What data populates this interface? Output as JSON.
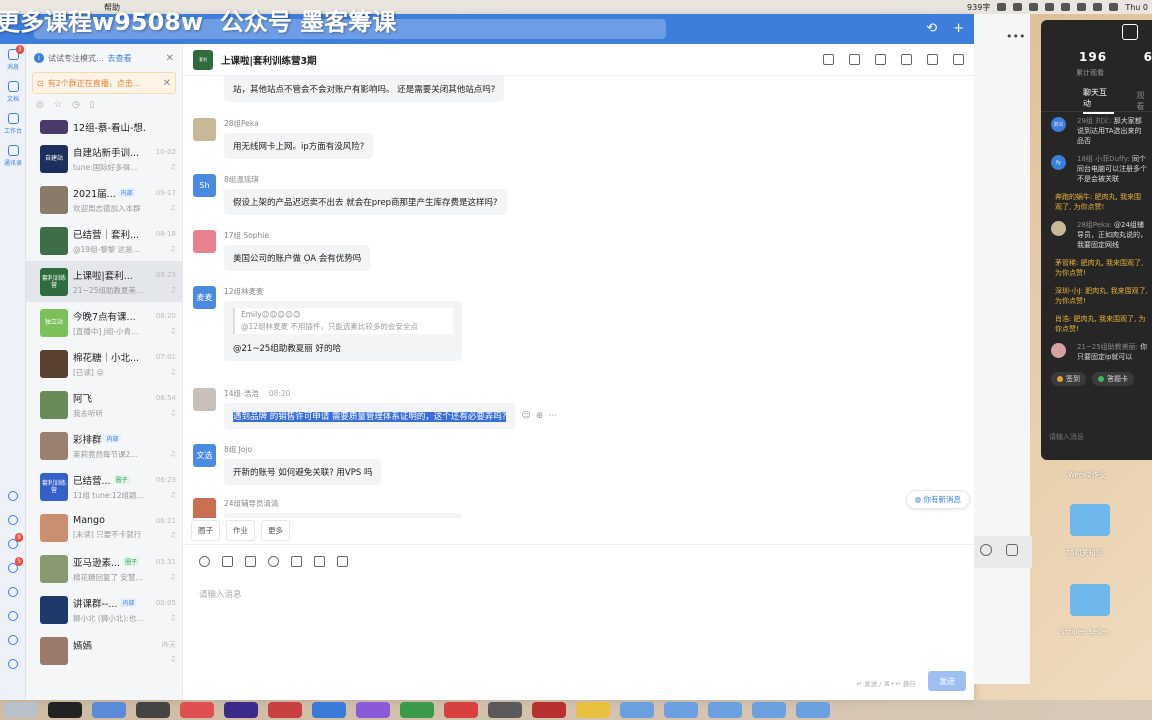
{
  "watermark": {
    "prefix": "更多课程",
    "brand": "w9508w",
    "suffix": "公众号 墨客筹课"
  },
  "menubar": {
    "help": "帮助",
    "stats": "939字",
    "clock": "Thu 0"
  },
  "rail": {
    "items": [
      {
        "label": "消息",
        "badge": "3"
      },
      {
        "label": "文档",
        "badge": ""
      },
      {
        "label": "工作台",
        "badge": ""
      },
      {
        "label": "通讯录",
        "badge": ""
      }
    ],
    "badges": [
      "9",
      "5"
    ]
  },
  "notices": {
    "tip_text": "试试专注模式...",
    "tip_link": "去查看",
    "live_text": "有2个群正在直播，点击..."
  },
  "conversations": [
    {
      "name": "12组-蔡-看山-想...",
      "tag": "",
      "time": "",
      "msg": "",
      "avatar_text": "",
      "avatar_color": "#4b3b6b"
    },
    {
      "name": "自建站新手训...",
      "tag": "",
      "time": "10-02",
      "msg": "tune:国际好多得...",
      "avatar_text": "自建站",
      "avatar_color": "#1d2f5c"
    },
    {
      "name": "2021届...",
      "tag": "内部",
      "time": "09-17",
      "msg": "欢迎周志德加入本群",
      "avatar_text": "",
      "avatar_color": "#8a7a6a"
    },
    {
      "name": "已结营｜套利...",
      "tag": "",
      "time": "08-18",
      "msg": "@19组-黎黎 这是...",
      "avatar_text": "",
      "avatar_color": "#3e6e48"
    },
    {
      "name": "上课啦|套利...",
      "tag": "",
      "time": "08:23",
      "msg": "21~25组助教夏美...",
      "avatar_text": "套利训练营",
      "avatar_color": "#2e6b3d",
      "active": true
    },
    {
      "name": "今晚7点有课...",
      "tag": "",
      "time": "08:20",
      "msg": "[直播中] J组-小青...",
      "avatar_text": "独立站",
      "avatar_color": "#7cc05a",
      "live": true
    },
    {
      "name": "棉花糖｜小北...",
      "tag": "",
      "time": "07:01",
      "msg": "[已读] 😜",
      "avatar_text": "",
      "avatar_color": "#5a4030"
    },
    {
      "name": "阿飞",
      "tag": "",
      "time": "06:54",
      "msg": "我去听听",
      "avatar_text": "",
      "avatar_color": "#6b8a5a"
    },
    {
      "name": "彩排群",
      "tag": "内部",
      "time": "",
      "msg": "莱莉竟然每节课2...",
      "avatar_text": "",
      "avatar_color": "#9a8070"
    },
    {
      "name": "已结营...",
      "tag": "圈子",
      "time": "06:23",
      "msg": "11组 tune:12组颖...",
      "avatar_text": "套利训练营",
      "avatar_color": "#3460c8"
    },
    {
      "name": "Mango",
      "tag": "",
      "time": "06:21",
      "msg": "[未读] 只要不卡就行",
      "avatar_text": "",
      "avatar_color": "#c89070",
      "unread": true
    },
    {
      "name": "亚马逊素...",
      "tag": "圈子",
      "time": "03:31",
      "msg": "棉花糖回复了 安慧...",
      "avatar_text": "",
      "avatar_color": "#8a9a70"
    },
    {
      "name": "讲课群--...",
      "tag": "内部",
      "time": "00:05",
      "msg": "狮小北 (狮小北):也...",
      "avatar_text": "",
      "avatar_color": "#1d3a6b"
    },
    {
      "name": "嫣嫣",
      "tag": "",
      "time": "昨天",
      "msg": "",
      "avatar_text": "",
      "avatar_color": "#9a7a6a"
    }
  ],
  "chat": {
    "title": "上课啦|套利训练营3期",
    "messages": [
      {
        "sender": "",
        "time": "",
        "text": "站，其他站点不管会不会对账户有影响吗。 还是需要关闭其他站点吗?",
        "avatar_text": "",
        "avatar_color": ""
      },
      {
        "sender": "28组Peka",
        "time": "",
        "text": "用无线网卡上网。ip方面有没风险?",
        "avatar_text": "",
        "avatar_color": "#c8b898"
      },
      {
        "sender": "8组温瑶琪",
        "time": "",
        "text": "假设上架的产品迟迟卖不出去 就会在prep商那里产生库存费是这样吗?",
        "avatar_text": "Sh",
        "avatar_color": "#4a8ae0"
      },
      {
        "sender": "17组 Sophie",
        "time": "",
        "text": "美国公司的账户做 OA 会有优势吗",
        "avatar_text": "",
        "avatar_color": "#e88090"
      },
      {
        "sender": "12组林麦麦",
        "time": "",
        "quote_title": "Emily😊😊😊😊😊",
        "quote_text": "@12组林麦麦 不用插件，只能选素比较多的会安全点",
        "text": "@21~25组助教夏丽 好的哈",
        "avatar_text": "麦麦",
        "avatar_color": "#4a8ae0"
      },
      {
        "sender": "14组-浩浩",
        "time": "08:20",
        "text": "遇到品牌 的销售许可申请 需要质量管理体系证明的，这个还有必要弄吗?",
        "avatar_text": "",
        "avatar_color": "#c8c0b8"
      },
      {
        "sender": "8组 Jojo",
        "time": "",
        "text": "开新的账号 如何避免关联? 用VPS 吗",
        "avatar_text": "文选",
        "avatar_color": "#4a8ae0"
      },
      {
        "sender": "24组辅导员清清",
        "time": "",
        "text": "",
        "avatar_text": "",
        "avatar_color": "#c87050"
      }
    ],
    "new_msg": "你有新消息",
    "quick_tags": [
      "圈子",
      "作业",
      "更多"
    ],
    "input_placeholder": "请输入消息",
    "send_hint": "↵ 发送 / ⌘+↵ 换行",
    "send_label": "发送"
  },
  "live": {
    "viewers": "196",
    "viewers_label": "累计观看",
    "second_num": "6",
    "tab_active": "聊天互动",
    "tab_other": "观看",
    "comments": [
      {
        "name": "29组 刘义:",
        "text": "那大家都说到达用TA选出来的品否",
        "avatar_text": "刘义",
        "avatar_color": "#3d7ddc",
        "gift": false
      },
      {
        "name": "18组 小菲Duffy:",
        "text": "同个同台电脑可以注册多个不是会被关联",
        "avatar_text": "fy",
        "avatar_color": "#3d7ddc",
        "gift": false
      },
      {
        "name": "",
        "text": "奔跑的蜗牛: 肥肉丸, 我来围观了, 为你点赞!",
        "avatar_text": "",
        "avatar_color": "",
        "gift": true
      },
      {
        "name": "28组Peka:",
        "text": "@24组辅导员，正如肉丸说的，我要固定网线",
        "avatar_text": "",
        "avatar_color": "#c8b898",
        "gift": false
      },
      {
        "name": "",
        "text": "茅管稀: 肥肉丸, 我来围观了, 为你点赞!",
        "avatar_text": "",
        "avatar_color": "",
        "gift": true
      },
      {
        "name": "",
        "text": "深圳-小J: 肥肉丸, 我来围观了, 为你点赞!",
        "avatar_text": "",
        "avatar_color": "",
        "gift": true
      },
      {
        "name": "",
        "text": "肖浩: 肥肉丸, 我来围观了, 为你点赞!",
        "avatar_text": "",
        "avatar_color": "",
        "gift": true
      },
      {
        "name": "21~25组助教美丽:",
        "text": "你只要固定ip就可以",
        "avatar_text": "",
        "avatar_color": "#d8a0a0",
        "gift": false
      }
    ],
    "btn_checkin": "签到",
    "btn_reward": "答题卡",
    "input_placeholder": "请输入消息"
  },
  "desktop": {
    "label_week": "Week2作业",
    "folder1": "TA相关知识",
    "folder2": "Shopee Seller"
  }
}
